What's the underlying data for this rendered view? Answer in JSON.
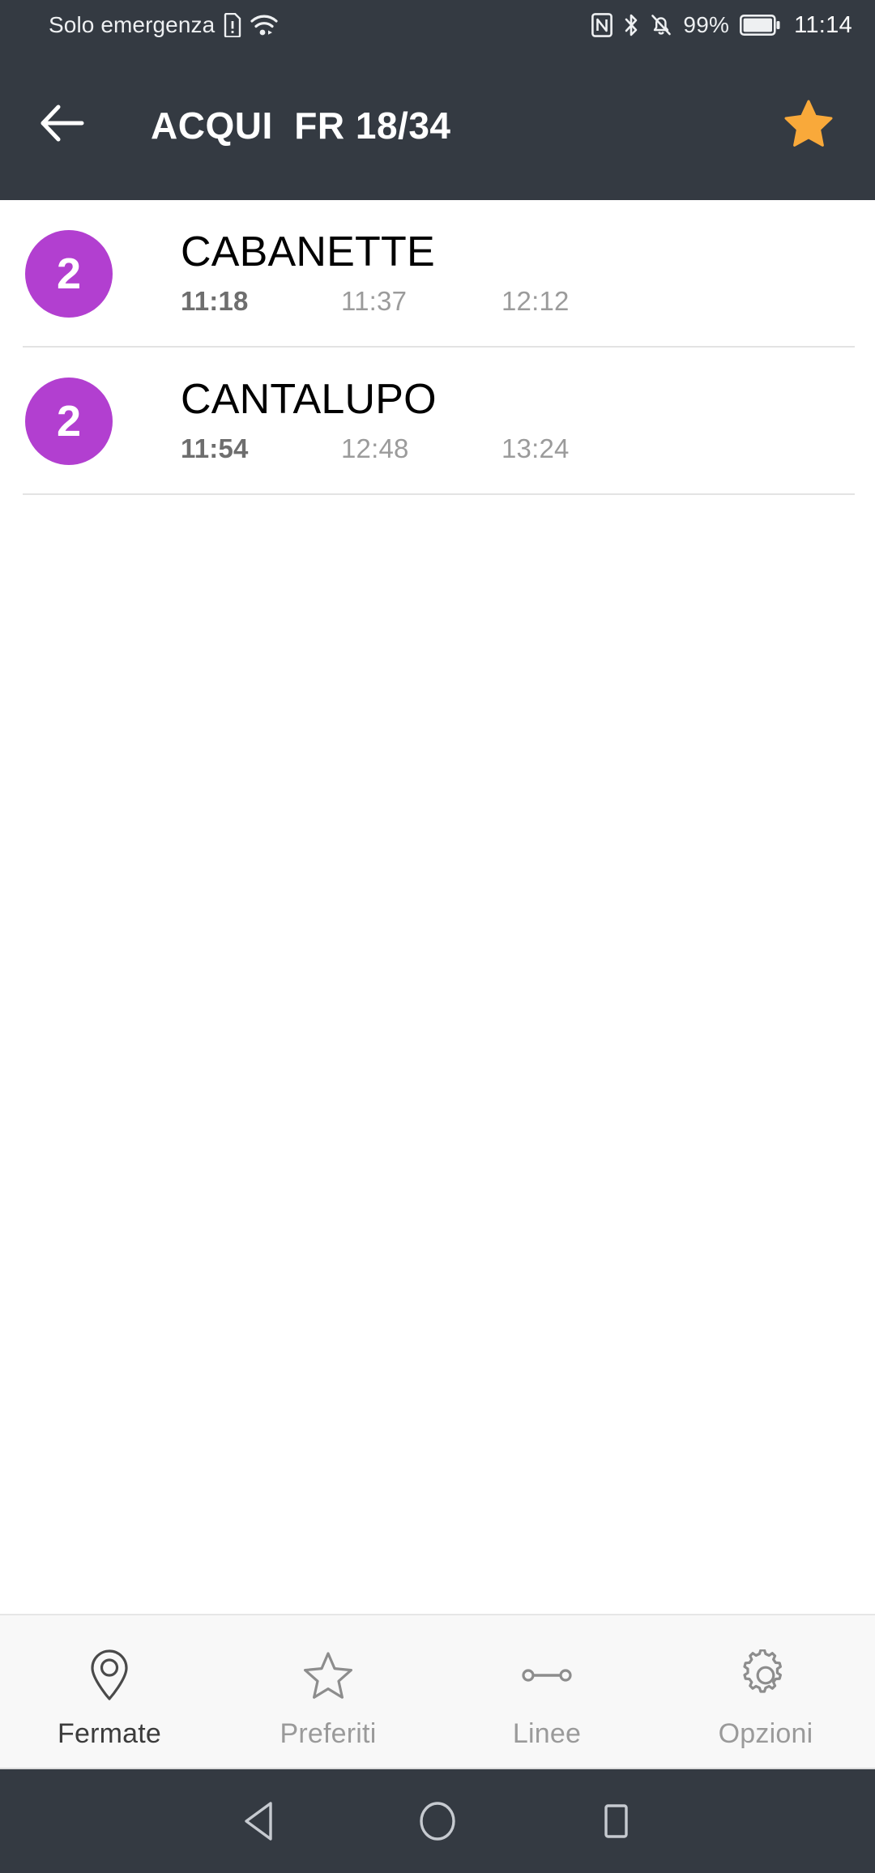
{
  "status_bar": {
    "carrier": "Solo emergenza",
    "sim_icon": "sim-alert-icon",
    "wifi_icon": "wifi-icon",
    "nfc_icon": "nfc-icon",
    "bluetooth_icon": "bluetooth-icon",
    "silent_icon": "bell-muted-icon",
    "battery_percent": "99%",
    "battery_icon": "battery-full-icon",
    "clock": "11:14",
    "background_color": "#343a42",
    "foreground_color": "#eef0f2"
  },
  "app_bar": {
    "back_icon": "arrow-left-icon",
    "title": "ACQUI  FR 18/34",
    "favorite_icon": "star-filled-icon",
    "favorite_active": true,
    "favorite_color": "#f9a93a",
    "background_color": "#343a42"
  },
  "stops": [
    {
      "line": "2",
      "line_color": "#b23fd0",
      "name": "CABANETTE",
      "times": [
        "11:18",
        "11:37",
        "12:12"
      ]
    },
    {
      "line": "2",
      "line_color": "#b23fd0",
      "name": "CANTALUPO",
      "times": [
        "11:54",
        "12:48",
        "13:24"
      ]
    }
  ],
  "bottom_nav": {
    "active_index": 0,
    "items": [
      {
        "label": "Fermate",
        "icon": "map-pin-icon"
      },
      {
        "label": "Preferiti",
        "icon": "star-outline-icon"
      },
      {
        "label": "Linee",
        "icon": "transit-line-icon"
      },
      {
        "label": "Opzioni",
        "icon": "gear-icon"
      }
    ]
  },
  "android_nav": {
    "back": "triangle-back-icon",
    "home": "circle-home-icon",
    "recents": "square-recents-icon",
    "background_color": "#343a42"
  }
}
